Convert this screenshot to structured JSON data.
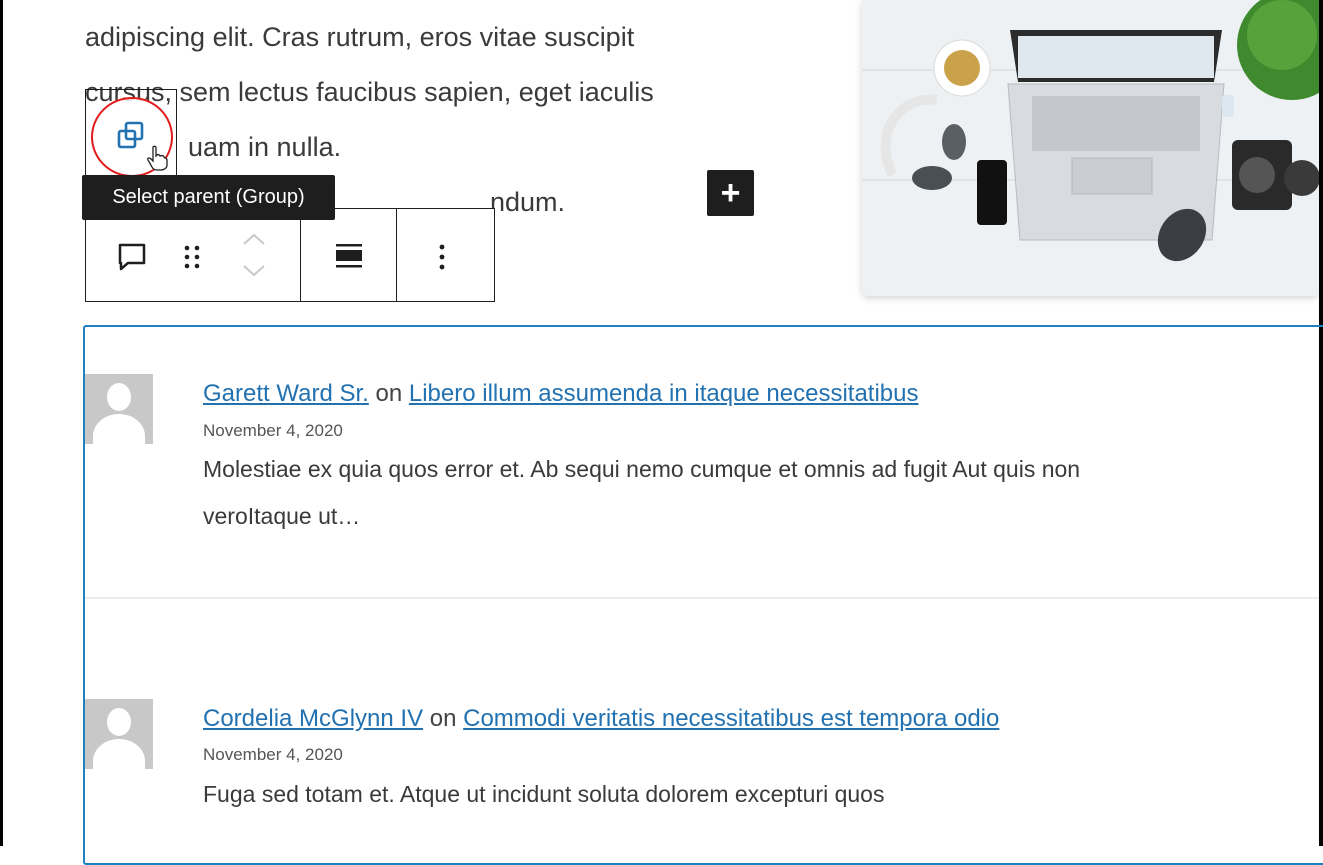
{
  "paragraph": {
    "line1": "adipiscing elit. Cras rutrum, eros vitae suscipit",
    "line2": "cursus, sem lectus faucibus sapien, eget iaculis",
    "line3": "uam in nulla.",
    "line4": "ndum."
  },
  "tooltip": "Select parent (Group)",
  "toolbar": {
    "icons": [
      "comment-icon",
      "drag-handle-icon",
      "move-up-icon",
      "move-down-icon",
      "align-icon",
      "more-options-icon"
    ]
  },
  "add_block": "+",
  "colors": {
    "link": "#2271b1",
    "selection": "#1e82c0",
    "highlight": "#e21b1b",
    "dark": "#1e1e1e"
  },
  "comments": [
    {
      "author": "Garett Ward Sr.",
      "on": "on",
      "post": "Libero illum assumenda in itaque necessitatibus",
      "date": "November 4, 2020",
      "text_line1": "Molestiae ex quia quos error et. Ab sequi nemo cumque et omnis ad fugit Aut quis non",
      "text_line2": "veroItaque ut…"
    },
    {
      "author": "Cordelia McGlynn IV",
      "on": "on",
      "post": "Commodi veritatis necessitatibus est tempora odio",
      "date": "November 4, 2020",
      "text_line1": "Fuga sed totam et. Atque ut incidunt soluta dolorem excepturi quos"
    }
  ]
}
